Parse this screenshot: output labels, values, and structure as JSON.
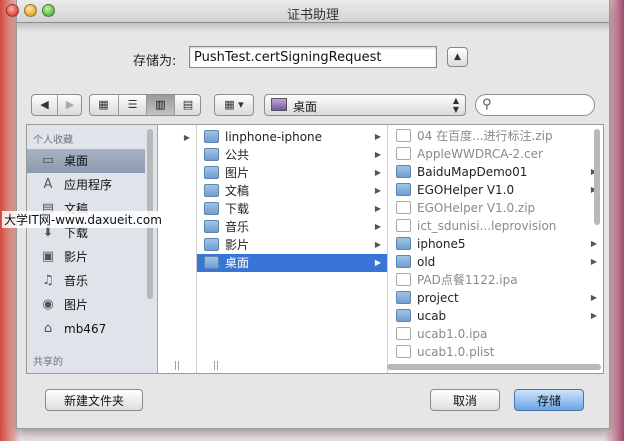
{
  "window": {
    "title": "证书助理"
  },
  "save_as": {
    "label": "存储为:",
    "value": "PushTest.certSigningRequest"
  },
  "toolbar": {
    "location": "桌面"
  },
  "sidebar": {
    "section_favorites": "个人收藏",
    "favorites": [
      {
        "label": "桌面",
        "icon": "desktop-icon",
        "selected": true
      },
      {
        "label": "应用程序",
        "icon": "applications-icon"
      },
      {
        "label": "文稿",
        "icon": "documents-icon"
      },
      {
        "label": "下载",
        "icon": "downloads-icon"
      },
      {
        "label": "影片",
        "icon": "movies-icon"
      },
      {
        "label": "音乐",
        "icon": "music-icon"
      },
      {
        "label": "图片",
        "icon": "pictures-icon"
      },
      {
        "label": "mb467",
        "icon": "home-icon"
      }
    ],
    "section_shared": "共享的"
  },
  "column2": [
    {
      "label": "linphone-iphone",
      "folder": true,
      "arrow": true
    },
    {
      "label": "公共",
      "folder": true,
      "arrow": true
    },
    {
      "label": "图片",
      "folder": true,
      "arrow": true
    },
    {
      "label": "文稿",
      "folder": true,
      "arrow": true
    },
    {
      "label": "下载",
      "folder": true,
      "arrow": true
    },
    {
      "label": "音乐",
      "folder": true,
      "arrow": true
    },
    {
      "label": "影片",
      "folder": true,
      "arrow": true
    },
    {
      "label": "桌面",
      "folder": true,
      "arrow": true,
      "selected": true
    }
  ],
  "column3": [
    {
      "label": "04 在百度...进行标注.zip",
      "folder": false,
      "dim": true
    },
    {
      "label": "AppleWWDRCA-2.cer",
      "folder": false,
      "dim": true
    },
    {
      "label": "BaiduMapDemo01",
      "folder": true,
      "arrow": true
    },
    {
      "label": "EGOHelper V1.0",
      "folder": true,
      "arrow": true
    },
    {
      "label": "EGOHelper V1.0.zip",
      "folder": false,
      "dim": true
    },
    {
      "label": "ict_sdunisi...leprovision",
      "folder": false,
      "dim": true
    },
    {
      "label": "iphone5",
      "folder": true,
      "arrow": true
    },
    {
      "label": "old",
      "folder": true,
      "arrow": true
    },
    {
      "label": "PAD点餐1122.ipa",
      "folder": false,
      "dim": true
    },
    {
      "label": "project",
      "folder": true,
      "arrow": true
    },
    {
      "label": "ucab",
      "folder": true,
      "arrow": true
    },
    {
      "label": "ucab1.0.ipa",
      "folder": false,
      "dim": true
    },
    {
      "label": "ucab1.0.plist",
      "folder": false,
      "dim": true
    }
  ],
  "buttons": {
    "new_folder": "新建文件夹",
    "cancel": "取消",
    "save": "存储"
  },
  "watermark": "大学IT网-www.daxueit.com"
}
